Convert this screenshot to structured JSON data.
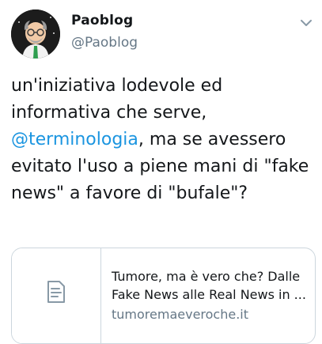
{
  "tweet": {
    "author": {
      "display_name": "Paoblog",
      "handle": "@Paoblog",
      "avatar_icon": "cartoon-avatar-icon"
    },
    "menu_icon": "chevron-down-icon",
    "text_before_mention": "un'iniziativa lodevole ed informativa che serve, ",
    "mention": "@terminologia",
    "text_after_mention": ", ma se avessero evitato l'uso a piene mani di \"fake news\" a favore di \"bufale\"?",
    "link_card": {
      "thumb_icon": "document-icon",
      "title_line1": "Tumore, ma è vero che? Dalle",
      "title_line2": "Fake News alle Real News in ...",
      "domain": "tumoremaeveroche.it"
    }
  },
  "colors": {
    "text": "#14171a",
    "secondary": "#657786",
    "link": "#1b95e0",
    "border": "#ccd6dd"
  }
}
